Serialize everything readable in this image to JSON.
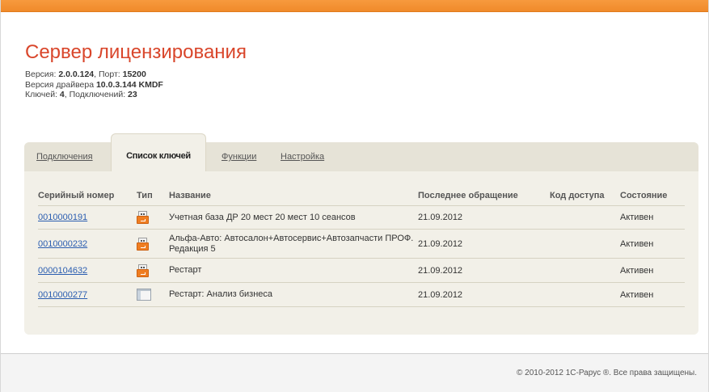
{
  "header": {
    "title": "Сервер лицензирования",
    "version_label": "Версия: ",
    "version_value": "2.0.0.124",
    "port_label": ", Порт: ",
    "port_value": "15200",
    "driver_label": "Версия драйвера ",
    "driver_value": "10.0.3.144 KMDF",
    "keys_label": "Ключей: ",
    "keys_value": "4",
    "connections_label": ", Подключений: ",
    "connections_value": "23"
  },
  "tabs": [
    {
      "label": "Подключения",
      "active": false
    },
    {
      "label": "Список ключей",
      "active": true
    },
    {
      "label": "Функции",
      "active": false
    },
    {
      "label": "Настройка",
      "active": false
    }
  ],
  "table": {
    "columns": [
      "Серийный номер",
      "Тип",
      "Название",
      "Последнее обращение",
      "Код доступа",
      "Состояние"
    ],
    "rows": [
      {
        "serial": "0010000191",
        "type_icon": "usb-key-icon",
        "name": "Учетная база ДР 20 мест 20 мест 10 сеансов",
        "last_access": "21.09.2012",
        "access_code": "",
        "status": "Активен"
      },
      {
        "serial": "0010000232",
        "type_icon": "usb-key-icon",
        "name": "Альфа-Авто: Автосалон+Автосервис+Автозапчасти ПРОФ. Редакция 5",
        "last_access": "21.09.2012",
        "access_code": "",
        "status": "Активен"
      },
      {
        "serial": "0000104632",
        "type_icon": "usb-key-icon",
        "name": "Рестарт",
        "last_access": "21.09.2012",
        "access_code": "",
        "status": "Активен"
      },
      {
        "serial": "0010000277",
        "type_icon": "software-key-icon",
        "name": "Рестарт: Анализ бизнеса",
        "last_access": "21.09.2012",
        "access_code": "",
        "status": "Активен"
      }
    ]
  },
  "footer": {
    "copyright": "© 2010-2012 1С-Рарус ®. Все права защищены."
  },
  "colors": {
    "accent_orange": "#f08a2a",
    "title_red": "#d9462b",
    "link_blue": "#2a5db0",
    "status_green": "#4e9a3a"
  }
}
